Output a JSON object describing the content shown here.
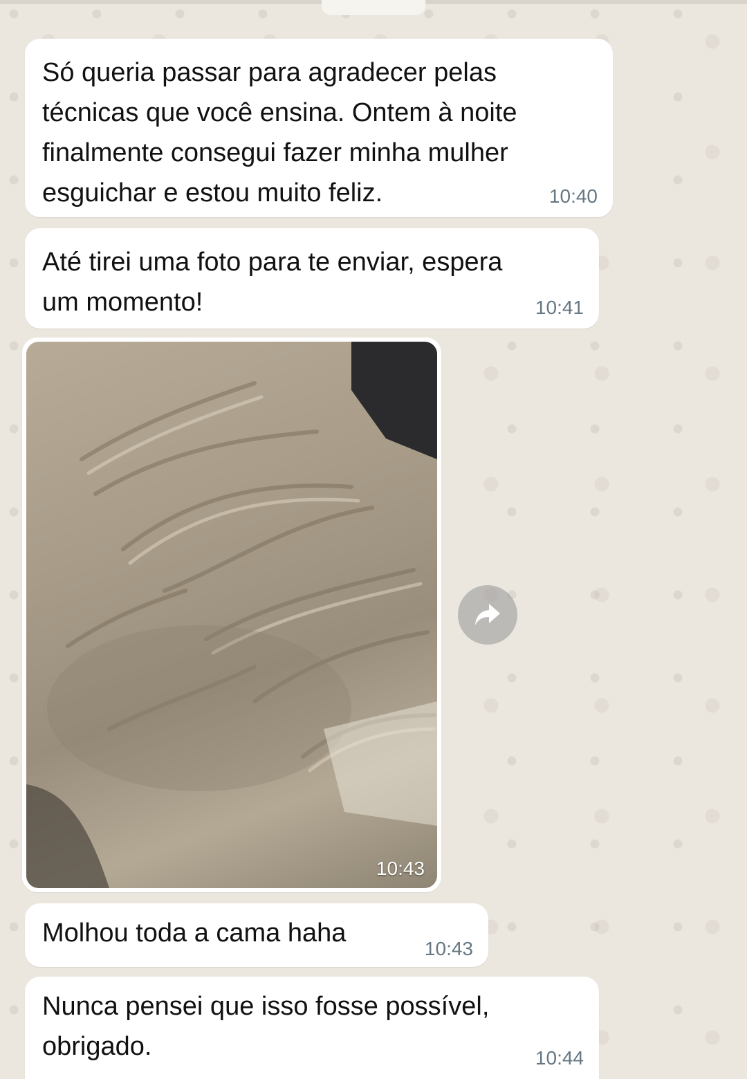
{
  "messages": [
    {
      "text": "Só queria passar para agradecer pelas\ntécnicas que você ensina. Ontem à noite\nfinalmente consegui fazer minha mulher\nesguichar e estou muito feliz.",
      "time": "10:40"
    },
    {
      "text": "Até tirei uma foto para te enviar, espera\num momento!",
      "time": "10:41"
    },
    {
      "image": "photo of rumpled bed sheet",
      "time": "10:43"
    },
    {
      "text": "Molhou toda a cama haha",
      "time": "10:43"
    },
    {
      "text": "Nunca pensei que isso fosse possível,\nobrigado.",
      "time": "10:44"
    }
  ],
  "icons": {
    "forward": "forward-arrow-icon"
  },
  "colors": {
    "bubble": "#ffffff",
    "background": "#ebe7df",
    "timestamp": "#667781"
  }
}
